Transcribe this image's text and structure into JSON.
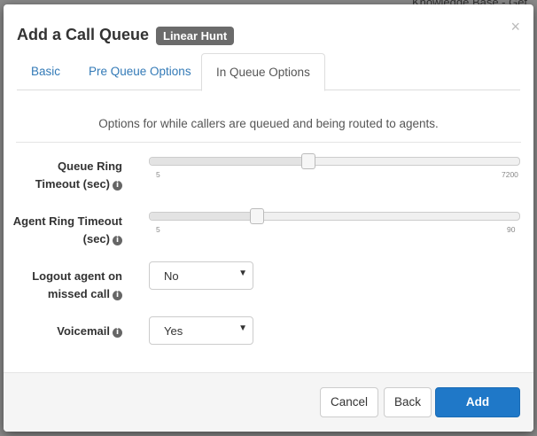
{
  "background": {
    "kb_text": "Knowledge Base - Get"
  },
  "modal": {
    "title": "Add a Call Queue",
    "badge": "Linear Hunt",
    "close": "×"
  },
  "tabs": [
    {
      "label": "Basic",
      "active": false
    },
    {
      "label": "Pre Queue Options",
      "active": false
    },
    {
      "label": "In Queue Options",
      "active": true
    }
  ],
  "pane": {
    "description": "Options for while callers are queued and being routed to agents.",
    "queue_ring_timeout": {
      "label_line1": "Queue Ring",
      "label_line2": "Timeout (sec)",
      "min": "5",
      "max": "7200",
      "value_fraction": 0.43
    },
    "agent_ring_timeout": {
      "label_line1": "Agent Ring Timeout",
      "label_line2": "(sec)",
      "min": "5",
      "max": "90",
      "value_fraction": 0.29
    },
    "logout_agent": {
      "label_line1": "Logout agent on",
      "label_line2": "missed call",
      "value": "No"
    },
    "voicemail": {
      "label": "Voicemail",
      "value": "Yes"
    }
  },
  "footer": {
    "cancel": "Cancel",
    "back": "Back",
    "add": "Add"
  },
  "colors": {
    "primary": "#1f78c8",
    "badge": "#6b6b6b",
    "link": "#337ab7"
  },
  "icons": {
    "info": "info-circle-icon",
    "chevron": "chevron-down-icon",
    "close": "close-icon"
  }
}
